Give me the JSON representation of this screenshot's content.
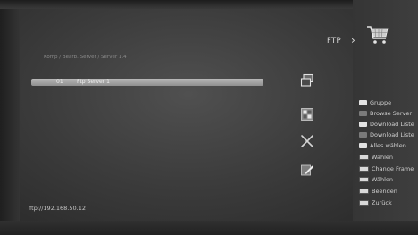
{
  "header": {
    "title": "FTP"
  },
  "breadcrumb": "Komp / Bearb. Server / Server 1.4",
  "servers": [
    {
      "num": "01",
      "name": "Ftp Server 1"
    }
  ],
  "status": {
    "ip": "ftp://192.168.50.12"
  },
  "icons": [
    "change-frame-icon",
    "select-icon",
    "delete-icon",
    "edit-icon"
  ],
  "legend": [
    {
      "label": "Gruppe"
    },
    {
      "label": "Browse Server"
    },
    {
      "label": "Download Liste"
    },
    {
      "label": "Download Liste"
    },
    {
      "label": "Alles wählen"
    },
    {
      "label": "Wählen"
    },
    {
      "label": "Change Frame"
    },
    {
      "label": "Wählen"
    },
    {
      "label": "Beenden"
    },
    {
      "label": "Zurück"
    }
  ],
  "colors": {
    "background": "#3c3c3c",
    "highlight": "#a8a8a8",
    "text": "#d0d0d0"
  }
}
